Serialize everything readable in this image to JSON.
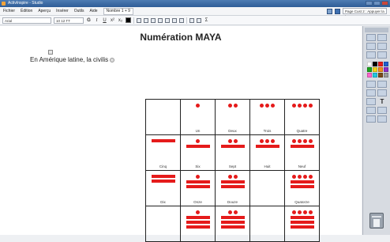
{
  "window": {
    "title": "ActivInspire - Studio"
  },
  "menu": {
    "items": [
      "Fichier",
      "Édition",
      "Aperçu",
      "Insérer",
      "Outils",
      "Aide"
    ],
    "doc_tab": "Nombre 1 + 9",
    "page_box": "Page Cust 2 : Appuyer la langue"
  },
  "format": {
    "font": "Arial",
    "size": "10 12 TT"
  },
  "page": {
    "title": "Numération MAYA",
    "intro": "En Amérique latine, la civilis"
  },
  "maya_table": [
    [
      {
        "dots": 0,
        "bars": 0,
        "label": ""
      },
      {
        "dots": 1,
        "bars": 0,
        "label": "Un"
      },
      {
        "dots": 2,
        "bars": 0,
        "label": "Deux"
      },
      {
        "dots": 3,
        "bars": 0,
        "label": "Trois"
      },
      {
        "dots": 4,
        "bars": 0,
        "label": "Quatre"
      }
    ],
    [
      {
        "dots": 0,
        "bars": 1,
        "label": "Cinq"
      },
      {
        "dots": 1,
        "bars": 1,
        "label": "Six"
      },
      {
        "dots": 2,
        "bars": 1,
        "label": "Sept"
      },
      {
        "dots": 3,
        "bars": 1,
        "label": "Huit"
      },
      {
        "dots": 4,
        "bars": 1,
        "label": "Neuf"
      }
    ],
    [
      {
        "dots": 0,
        "bars": 2,
        "label": "Dix"
      },
      {
        "dots": 1,
        "bars": 2,
        "label": "Onze"
      },
      {
        "dots": 2,
        "bars": 2,
        "label": "Douze"
      },
      {
        "dots": 0,
        "bars": 0,
        "label": ""
      },
      {
        "dots": 4,
        "bars": 2,
        "label": "Quatorze"
      }
    ],
    [
      {
        "dots": 0,
        "bars": 0,
        "label": ""
      },
      {
        "dots": 1,
        "bars": 3,
        "label": ""
      },
      {
        "dots": 2,
        "bars": 3,
        "label": ""
      },
      {
        "dots": 0,
        "bars": 0,
        "label": ""
      },
      {
        "dots": 4,
        "bars": 3,
        "label": ""
      }
    ]
  ],
  "colors": {
    "maya_red": "#e51b1b"
  },
  "tools": [
    "pointer-icon",
    "pen-icon",
    "highlighter-icon",
    "eraser-icon",
    "fill-icon",
    "text-icon",
    "shape-icon",
    "connector-icon",
    "zoom-icon",
    "undo-icon"
  ],
  "palette": [
    "#ffffff",
    "#000000",
    "#e51b1b",
    "#1e5fcf",
    "#1aa31a",
    "#f2d21a",
    "#f28a1a",
    "#8e2cc9",
    "#ff66cc",
    "#22c7e0",
    "#7a4a1a",
    "#9a9a9a"
  ]
}
